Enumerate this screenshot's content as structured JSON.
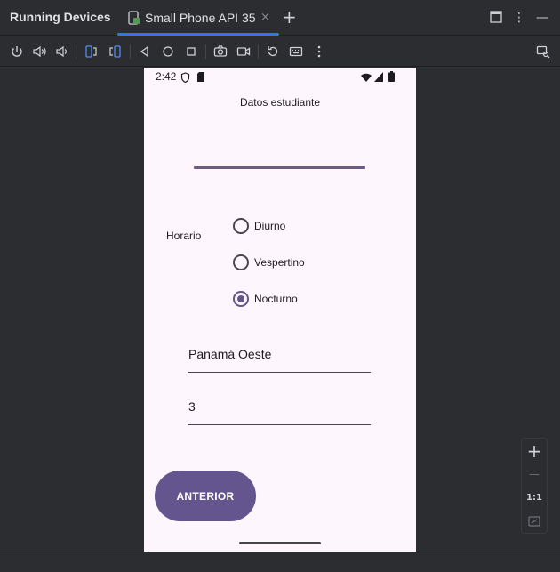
{
  "tool_window": {
    "title": "Running Devices",
    "tab_label": "Small Phone API 35",
    "tab_close": "×",
    "add_tab": "+"
  },
  "window_buttons": {
    "maximize_icon": "window-icon",
    "more": "⋮",
    "minimize": "—"
  },
  "toolbar_icons": [
    "power-icon",
    "volume-up-icon",
    "volume-down-icon",
    "rotate-left-icon",
    "rotate-right-icon",
    "back-icon",
    "home-icon",
    "overview-icon",
    "screenshot-icon",
    "screen-record-icon",
    "reset-icon",
    "keyboard-icon",
    "more-icon",
    "device-mirror-icon"
  ],
  "device": {
    "status_time": "2:42",
    "app_title": "Datos estudiante",
    "horario_label": "Horario",
    "radio_options": [
      {
        "label": "Diurno",
        "selected": false
      },
      {
        "label": "Vespertino",
        "selected": false
      },
      {
        "label": "Nocturno",
        "selected": true
      }
    ],
    "field_location": "Panamá Oeste",
    "field_number": "3",
    "prev_button": "ANTERIOR"
  },
  "zoom": {
    "zoom_in": "+",
    "zoom_out": "—",
    "actual_size": "1:1"
  },
  "colors": {
    "accent": "#65558f",
    "tab_underline": "#3574f0",
    "phone_bg": "#fdf7fd",
    "ide_bg": "#2b2d30"
  }
}
